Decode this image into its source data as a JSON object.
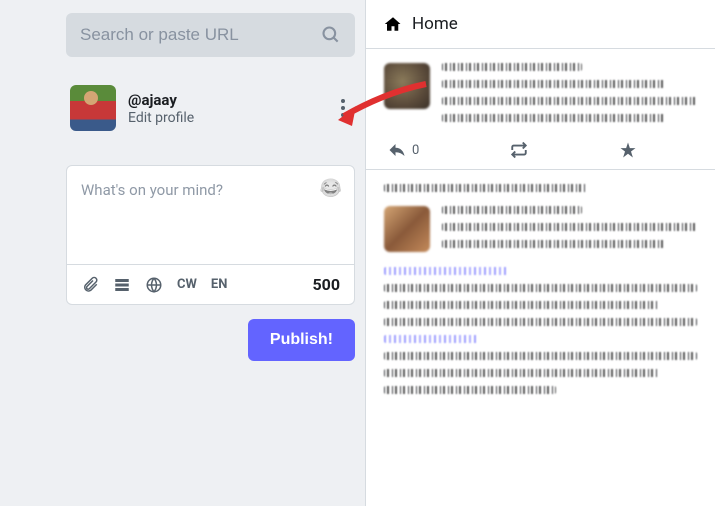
{
  "search": {
    "placeholder": "Search or paste URL"
  },
  "profile": {
    "handle": "@ajaay",
    "edit_label": "Edit profile"
  },
  "compose": {
    "placeholder": "What's on your mind?",
    "cw_label": "CW",
    "lang_label": "EN",
    "char_count": "500",
    "publish_label": "Publish!"
  },
  "timeline": {
    "title": "Home",
    "posts": [
      {
        "reply_count": "0"
      }
    ]
  },
  "colors": {
    "accent": "#6364ff"
  }
}
